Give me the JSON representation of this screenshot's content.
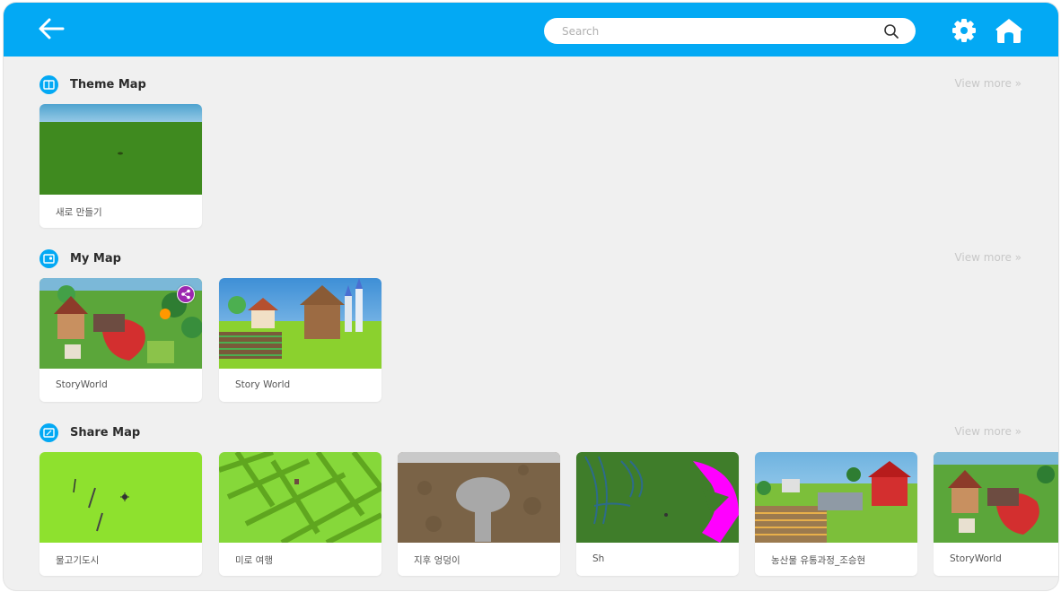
{
  "search": {
    "placeholder": "Search"
  },
  "icons": {
    "back": "arrow-left-icon",
    "search": "search-icon",
    "settings": "gear-icon",
    "home": "home-icon",
    "share": "share-icon"
  },
  "colors": {
    "accent": "#03a9f4",
    "background": "#f0f0f0",
    "card": "#ffffff"
  },
  "sections": {
    "theme": {
      "title": "Theme Map",
      "view_more": "View more  »",
      "cards": [
        {
          "label": "새로 만들기",
          "thumb": "grass-field"
        }
      ]
    },
    "my": {
      "title": "My Map",
      "view_more": "View more  »",
      "cards": [
        {
          "label": "StoryWorld",
          "thumb": "storyworld-village",
          "shared": true
        },
        {
          "label": "Story World",
          "thumb": "farm-castle"
        }
      ]
    },
    "share": {
      "title": "Share Map",
      "view_more": "View more  »",
      "cards": [
        {
          "label": "물고기도시",
          "thumb": "green-fish"
        },
        {
          "label": "미로 여행",
          "thumb": "green-maze"
        },
        {
          "label": "지후 엉덩이",
          "thumb": "dirt-shape"
        },
        {
          "label": "Sh",
          "thumb": "rollercoaster"
        },
        {
          "label": "농산물 유통과정_조승현",
          "thumb": "farm-village"
        },
        {
          "label": "StoryWorld",
          "thumb": "storyworld-village"
        }
      ]
    }
  }
}
